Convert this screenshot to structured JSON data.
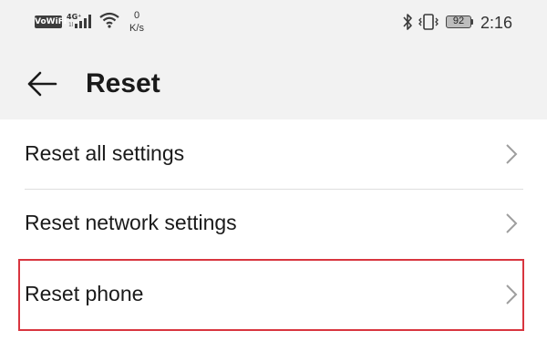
{
  "status_bar": {
    "vowifi_label": "VoWiFi",
    "network_type": "4G⁺",
    "network_sub": "1l",
    "speed_value": "0",
    "speed_unit": "K/s",
    "battery_level": "92",
    "time": "2:16"
  },
  "header": {
    "title": "Reset",
    "back_icon": "back-arrow-icon"
  },
  "settings": {
    "items": [
      {
        "label": "Reset all settings",
        "icon": "chevron-right-icon"
      },
      {
        "label": "Reset network settings",
        "icon": "chevron-right-icon"
      },
      {
        "label": "Reset phone",
        "icon": "chevron-right-icon",
        "highlighted": true
      }
    ]
  },
  "colors": {
    "header_bg": "#f2f2f2",
    "highlight_border": "#d8353f",
    "chevron": "#9e9e9e"
  }
}
